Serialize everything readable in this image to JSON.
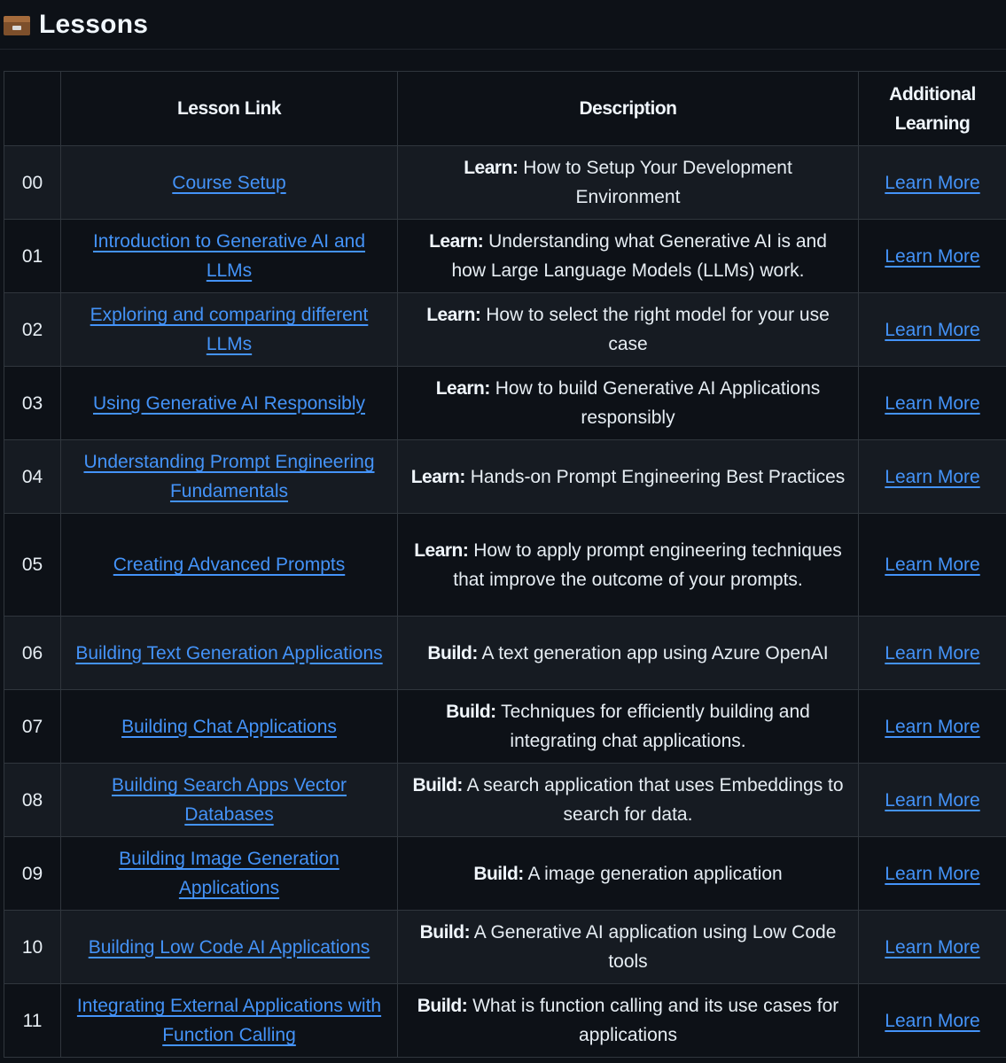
{
  "heading": {
    "icon": "card-file-box-icon",
    "title": "Lessons"
  },
  "table": {
    "columns": [
      "",
      "Lesson Link",
      "Description",
      "Additional Learning"
    ],
    "rows": [
      {
        "num": "00",
        "lesson": "Course Setup",
        "label": "Learn:",
        "desc": "How to Setup Your Development Environment",
        "more": "Learn More"
      },
      {
        "num": "01",
        "lesson": "Introduction to Generative AI and LLMs",
        "label": "Learn:",
        "desc": "Understanding what Generative AI is and how Large Language Models (LLMs) work.",
        "more": "Learn More"
      },
      {
        "num": "02",
        "lesson": "Exploring and comparing different LLMs",
        "label": "Learn:",
        "desc": "How to select the right model for your use case",
        "more": "Learn More"
      },
      {
        "num": "03",
        "lesson": "Using Generative AI Responsibly",
        "label": "Learn:",
        "desc": "How to build Generative AI Applications responsibly",
        "more": "Learn More"
      },
      {
        "num": "04",
        "lesson": "Understanding Prompt Engineering Fundamentals",
        "label": "Learn:",
        "desc": "Hands-on Prompt Engineering Best Practices",
        "more": "Learn More"
      },
      {
        "num": "05",
        "lesson": "Creating Advanced Prompts",
        "label": "Learn:",
        "desc": "How to apply prompt engineering techniques that improve the outcome of your prompts.",
        "more": "Learn More"
      },
      {
        "num": "06",
        "lesson": "Building Text Generation Applications",
        "label": "Build:",
        "desc": "A text generation app using Azure OpenAI",
        "more": "Learn More"
      },
      {
        "num": "07",
        "lesson": "Building Chat Applications",
        "label": "Build:",
        "desc": "Techniques for efficiently building and integrating chat applications.",
        "more": "Learn More"
      },
      {
        "num": "08",
        "lesson": "Building Search Apps Vector Databases",
        "label": "Build:",
        "desc": "A search application that uses Embeddings to search for data.",
        "more": "Learn More"
      },
      {
        "num": "09",
        "lesson": "Building Image Generation Applications",
        "label": "Build:",
        "desc": "A image generation application",
        "more": "Learn More"
      },
      {
        "num": "10",
        "lesson": "Building Low Code AI Applications",
        "label": "Build:",
        "desc": "A Generative AI application using Low Code tools",
        "more": "Learn More"
      },
      {
        "num": "11",
        "lesson": "Integrating External Applications with Function Calling",
        "label": "Build:",
        "desc": "What is function calling and its use cases for applications",
        "more": "Learn More"
      }
    ]
  },
  "colors": {
    "background": "#0d1117",
    "row_alt": "#161b22",
    "border": "#30363d",
    "link": "#4493f8",
    "text": "#e6edf3"
  }
}
